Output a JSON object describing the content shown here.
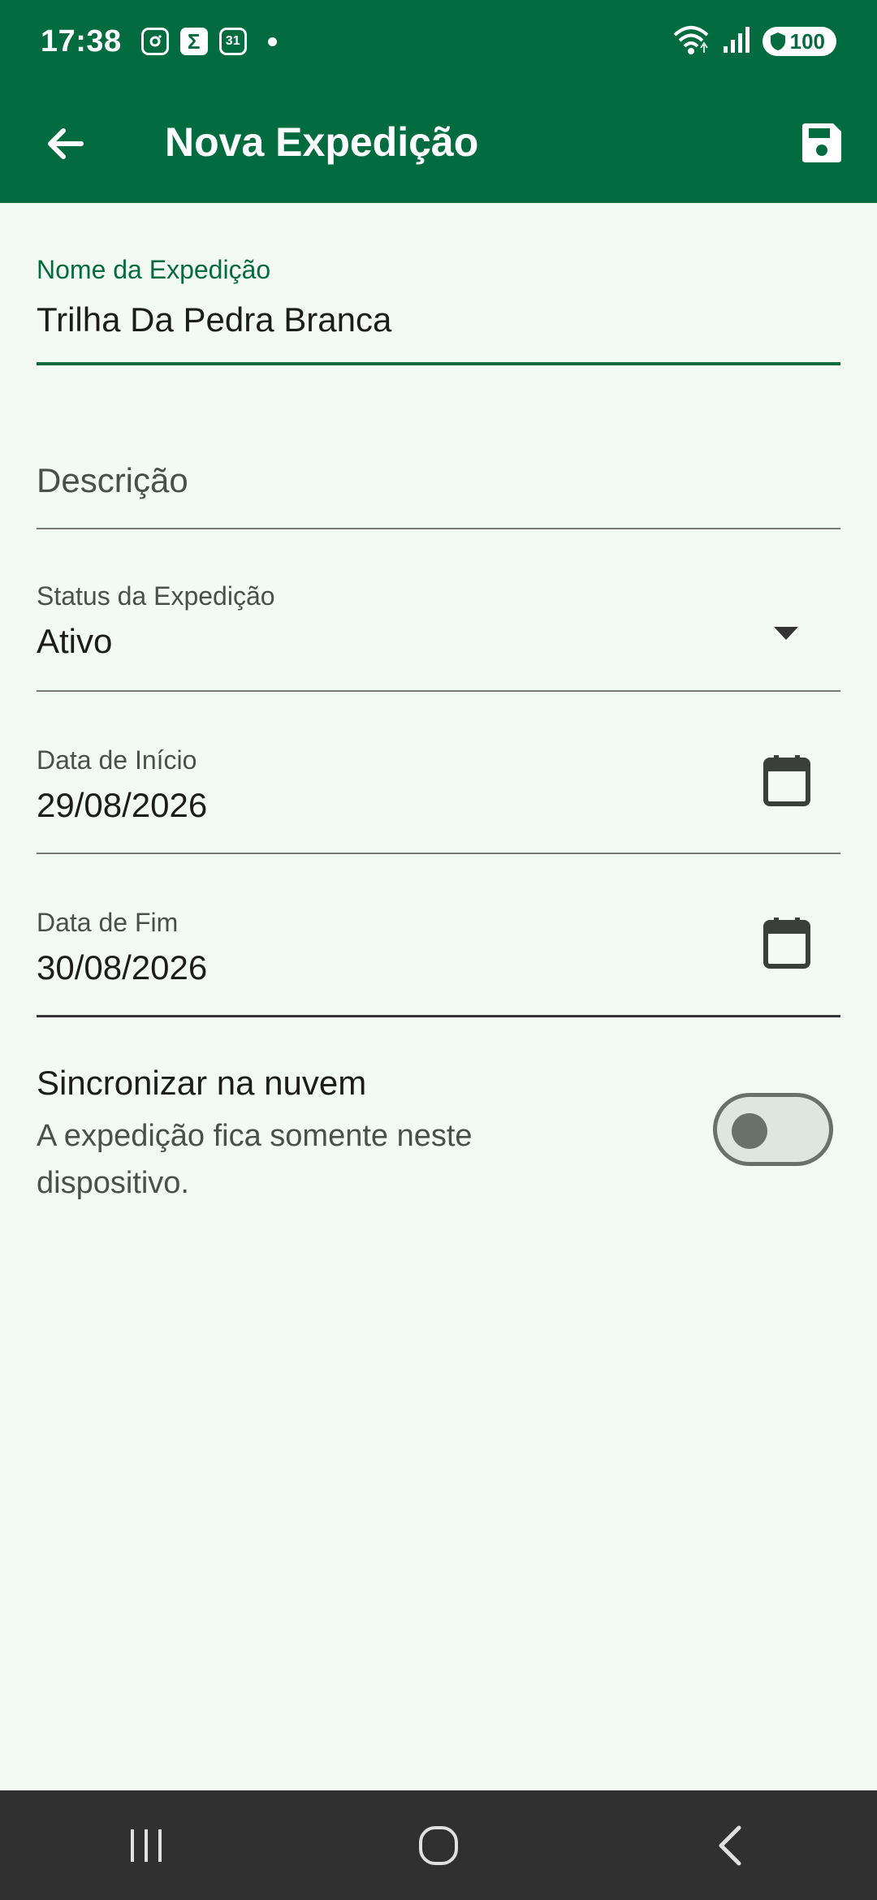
{
  "status_bar": {
    "time": "17:38",
    "calendar_badge": "31",
    "battery": "100",
    "icons": [
      "instagram-icon",
      "sigma-icon",
      "calendar-icon",
      "dot-icon",
      "wifi-icon",
      "signal-icon",
      "battery-icon"
    ]
  },
  "app_bar": {
    "title": "Nova Expedição",
    "back_icon": "arrow-back-icon",
    "save_icon": "save-icon"
  },
  "form": {
    "name": {
      "label": "Nome da Expedição",
      "value": "Trilha Da Pedra Branca"
    },
    "description": {
      "placeholder": "Descrição"
    },
    "status": {
      "label": "Status da Expedição",
      "value": "Ativo"
    },
    "start_date": {
      "label": "Data de Início",
      "value": "29/08/2026"
    },
    "end_date": {
      "label": "Data de Fim",
      "value": "30/08/2026"
    },
    "sync": {
      "title": "Sincronizar na nuvem",
      "subtitle": "A expedição fica somente neste dispositivo.",
      "enabled": false
    }
  },
  "colors": {
    "primary": "#036b40",
    "background": "#f3f9f3",
    "nav_bar": "#303030"
  }
}
